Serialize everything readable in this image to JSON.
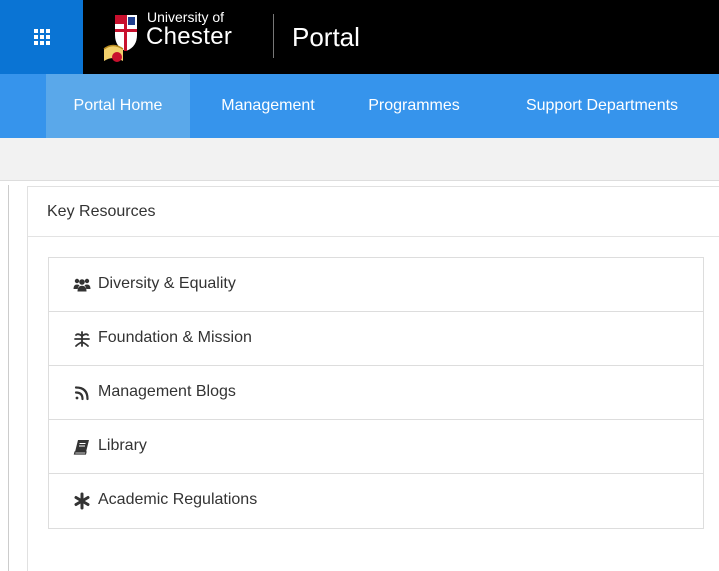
{
  "header": {
    "app_launcher_icon": "waffle-icon",
    "logo": {
      "line1": "University of",
      "line2": "Chester",
      "crest_icon": "university-crest-icon"
    },
    "site_title": "Portal",
    "colors": {
      "topbar": "#000000",
      "launcher": "#0a74d4"
    }
  },
  "nav": {
    "items": [
      {
        "label": "Portal Home",
        "active": true
      },
      {
        "label": "Management",
        "active": false
      },
      {
        "label": "Programmes",
        "active": false
      },
      {
        "label": "Support Departments",
        "active": false
      }
    ],
    "colors": {
      "bar": "#3694ec",
      "active": "#5aa8ea"
    }
  },
  "key_resources": {
    "title": "Key Resources",
    "items": [
      {
        "label": "Diversity & Equality",
        "icon": "users-icon"
      },
      {
        "label": "Foundation & Mission",
        "icon": "pilcrow-leaf-icon"
      },
      {
        "label": "Management Blogs",
        "icon": "rss-icon"
      },
      {
        "label": "Library",
        "icon": "book-icon"
      },
      {
        "label": "Academic Regulations",
        "icon": "asterisk-icon"
      }
    ]
  }
}
